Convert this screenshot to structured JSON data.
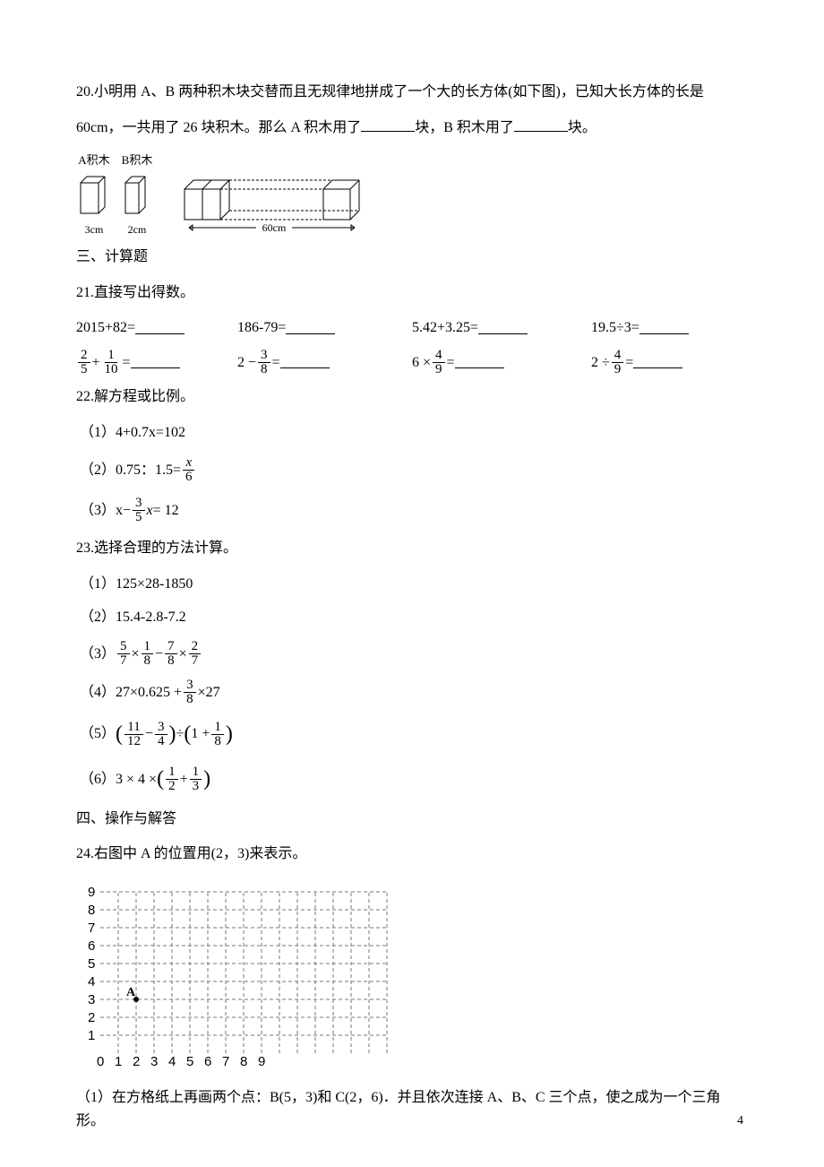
{
  "q20": {
    "part1": "20.小明用 A、B 两种积木块交替而且无规律地拼成了一个大的长方体(如下图)，已知大长方体的长是",
    "part2_a": "60cm，一共用了 26 块积木。那么 A 积木用了",
    "part2_b": "块，B 积木用了",
    "part2_c": "块。",
    "labelA": "A积木",
    "labelB": "B积木",
    "dimA": "3cm",
    "dimB": "2cm",
    "dimBig": "60cm"
  },
  "sec3": "三、计算题",
  "q21": {
    "title": "21.直接写出得数。"
  },
  "row1": {
    "c1": "2015+82=",
    "c2": "186-79= ",
    "c3": "5.42+3.25=",
    "c4": "19.5÷3="
  },
  "row2": {
    "f1n": "2",
    "f1d": "5",
    "f2n": "1",
    "f2d": "10",
    "plus": " + ",
    "eq": " = ",
    "c2a": "2 − ",
    "f3n": "3",
    "f3d": "8",
    "c3a": "6 × ",
    "f4n": "4",
    "f4d": "9",
    "c4a": "2 ÷ ",
    "f5n": "4",
    "f5d": "9"
  },
  "q22": {
    "title": "22.解方程或比例。",
    "p1": "（1）4+0.7x=102",
    "p2a": "（2）0.75：1.5= ",
    "p2n": "x",
    "p2d": "6",
    "p3a": "（3）x− ",
    "p3n": "3",
    "p3d": "5",
    "p3b": "x",
    "p3c": " = 12"
  },
  "q23": {
    "title": "23.选择合理的方法计算。",
    "p1": "（1）125×28-1850",
    "p2": "（2）15.4-2.8-7.2",
    "p3a": "（3）",
    "p3f1n": "5",
    "p3f1d": "7",
    "p3m1": " × ",
    "p3f2n": "1",
    "p3f2d": "8",
    "p3m2": " − ",
    "p3f3n": "7",
    "p3f3d": "8",
    "p3m3": " × ",
    "p3f4n": "2",
    "p3f4d": "7",
    "p4a": "（4）27×0.625 + ",
    "p4n": "3",
    "p4d": "8",
    "p4b": " ×27",
    "p5a": "（5）",
    "p5f1n": "11",
    "p5f1d": "12",
    "p5m1": " − ",
    "p5f2n": "3",
    "p5f2d": "4",
    "p5m2": " ÷ ",
    "p5m3": "1 + ",
    "p5f3n": "1",
    "p5f3d": "8",
    "p6a": "（6）3 × 4 × ",
    "p6f1n": "1",
    "p6f1d": "2",
    "p6m": " + ",
    "p6f2n": "1",
    "p6f2d": "3"
  },
  "sec4": "四、操作与解答",
  "q24": {
    "title": "24.右图中 A 的位置用(2，3)来表示。",
    "pointLabel": "A",
    "axisX": [
      "0",
      "1",
      "2",
      "3",
      "4",
      "5",
      "6",
      "7",
      "8",
      "9"
    ],
    "axisY": [
      "1",
      "2",
      "3",
      "4",
      "5",
      "6",
      "7",
      "8",
      "9"
    ],
    "sub1": "（1）在方格纸上再画两个点：B(5，3)和 C(2，6)．并且依次连接 A、B、C 三个点，使之成为一个三角形。"
  },
  "pageNumber": "4"
}
